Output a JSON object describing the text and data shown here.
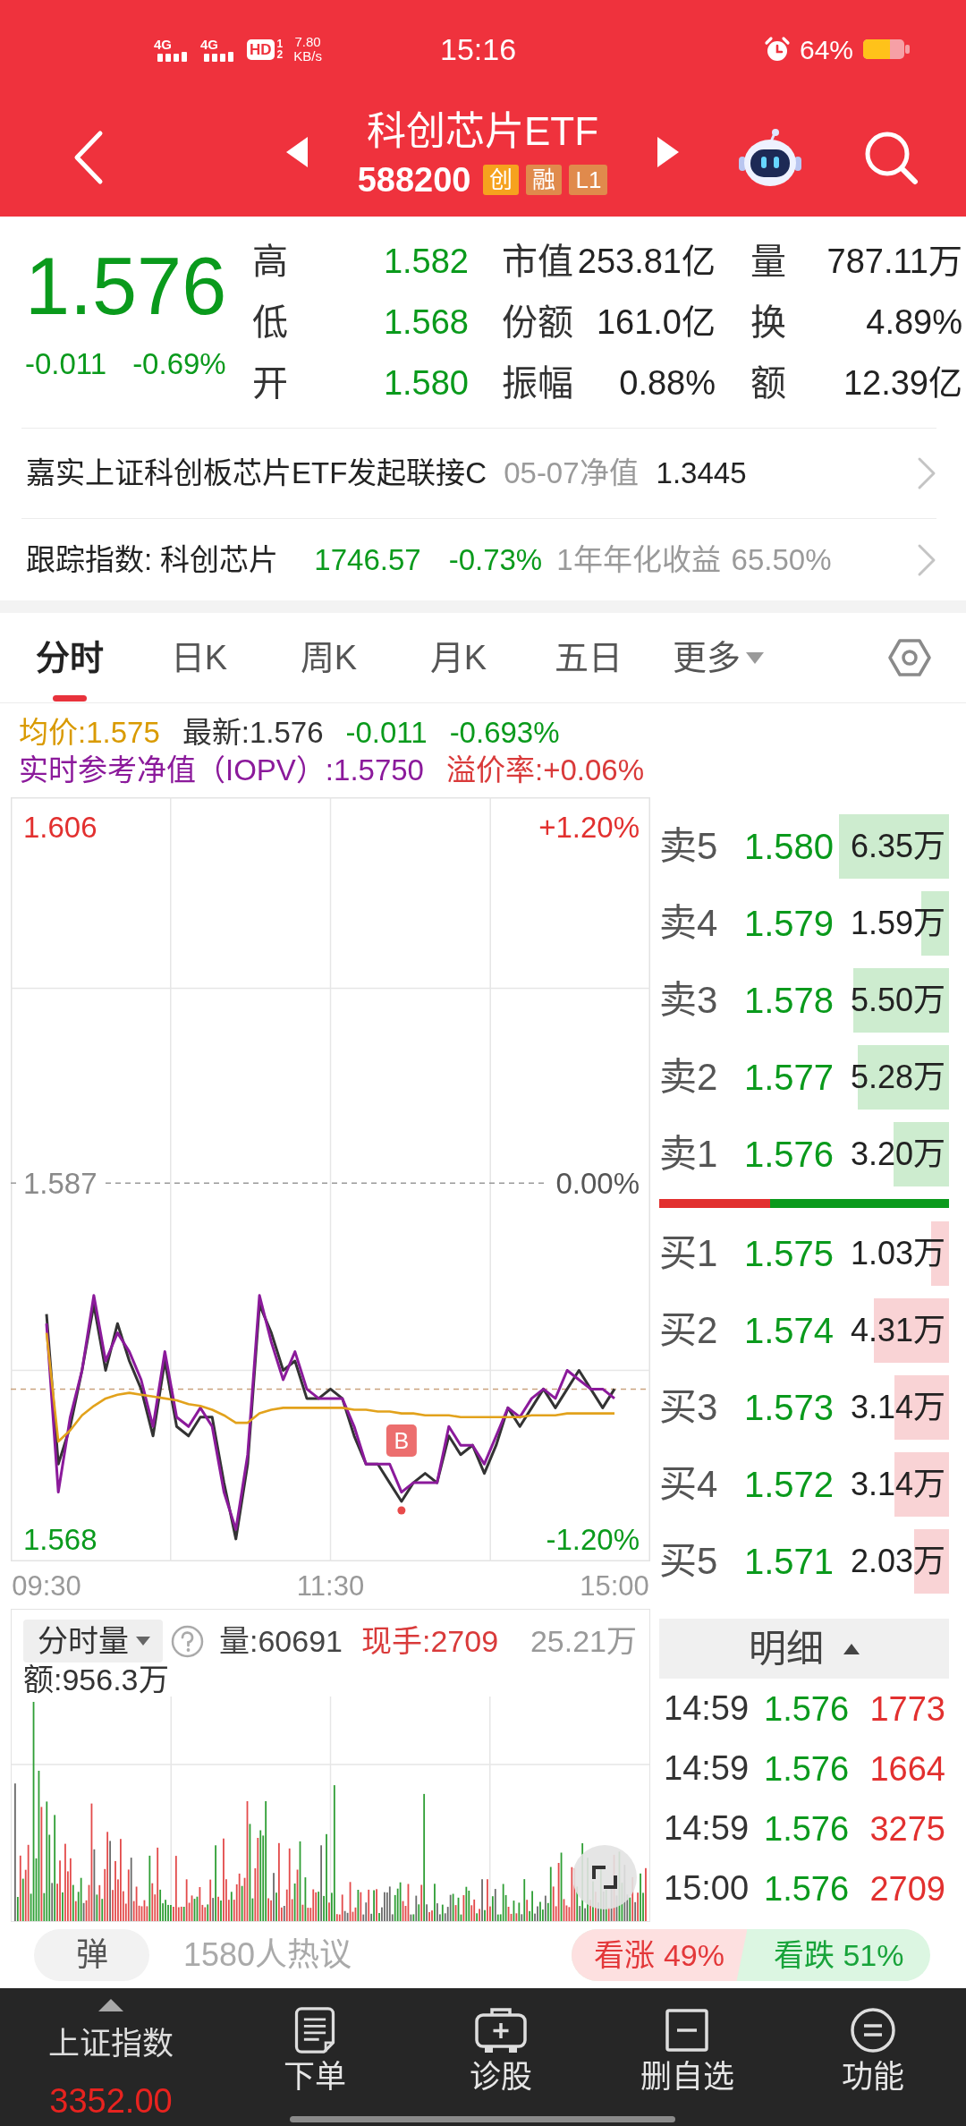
{
  "status_bar": {
    "networks": [
      "4G",
      "4G"
    ],
    "hd": "HD",
    "sim_slots": [
      "1",
      "2"
    ],
    "speed": "7.80",
    "speed_unit": "KB/s",
    "time": "15:16",
    "battery": "64%"
  },
  "header": {
    "title": "科创芯片ETF",
    "code": "588200",
    "tags": [
      {
        "text": "创",
        "color": "#f6a21e"
      },
      {
        "text": "融",
        "color": "#e08a4c"
      },
      {
        "text": "L1",
        "color": "#e08a4c"
      }
    ]
  },
  "quote": {
    "price_down": true,
    "price": "1.576",
    "change": "-0.011",
    "change_pct": "-0.69%",
    "stats": [
      [
        {
          "label": "高",
          "value": "1.582",
          "kind": "price"
        },
        {
          "label": "市值",
          "value": "253.81亿",
          "kind": "figure"
        },
        {
          "label": "量",
          "value": "787.11万",
          "kind": "figure"
        }
      ],
      [
        {
          "label": "低",
          "value": "1.568",
          "kind": "price"
        },
        {
          "label": "份额",
          "value": "161.0亿",
          "kind": "figure"
        },
        {
          "label": "换",
          "value": "4.89%",
          "kind": "figure"
        }
      ],
      [
        {
          "label": "开",
          "value": "1.580",
          "kind": "price"
        },
        {
          "label": "振幅",
          "value": "0.88%",
          "kind": "figure"
        },
        {
          "label": "额",
          "value": "12.39亿",
          "kind": "figure"
        }
      ]
    ]
  },
  "fund_link": {
    "name": "嘉实上证科创板芯片ETF发起联接C",
    "nav_label": "05-07净值",
    "nav": "1.3445"
  },
  "index_link": {
    "label": "跟踪指数: 科创芯片",
    "value": "1746.57",
    "change": "-0.73%",
    "down": true,
    "return_label": "1年年化收益",
    "return": "65.50%"
  },
  "tabs": [
    {
      "label": "分时",
      "selected": true,
      "kind": "tab"
    },
    {
      "label": "日K",
      "selected": false,
      "kind": "tab"
    },
    {
      "label": "周K",
      "selected": false,
      "kind": "tab"
    },
    {
      "label": "月K",
      "selected": false,
      "kind": "tab"
    },
    {
      "label": "五日",
      "selected": false,
      "kind": "tab"
    },
    {
      "label": "更多",
      "selected": false,
      "kind": "dropdown"
    }
  ],
  "intraday": {
    "average": "均价:1.575",
    "latest": "最新:1.576",
    "change": "-0.011",
    "change_pct": "-0.693%",
    "iopv": "实时参考净值（IOPV）:1.5750",
    "premium": "溢价率:+0.06%",
    "percent_ticks": [
      "+1.20%",
      "0.00%",
      "-1.20%"
    ],
    "chart_data": {
      "type": "line",
      "categories": [
        "09:30",
        null,
        null,
        null,
        null,
        null,
        null,
        null,
        null,
        null,
        null,
        null,
        null,
        null,
        null,
        null,
        null,
        null,
        null,
        null,
        null,
        null,
        null,
        null,
        "11:30",
        null,
        null,
        null,
        null,
        null,
        null,
        null,
        null,
        null,
        null,
        null,
        null,
        null,
        null,
        null,
        null,
        null,
        null,
        null,
        null,
        null,
        null,
        null,
        "15:00"
      ],
      "series": [
        {
          "color": "#333333",
          "values": [
            1.58,
            1.572,
            1.574,
            1.577,
            1.5805,
            1.577,
            1.5795,
            1.5775,
            1.576,
            1.5735,
            1.5775,
            1.574,
            1.5735,
            1.5745,
            1.5745,
            1.571,
            1.568,
            1.572,
            1.5805,
            1.579,
            1.577,
            1.5775,
            1.5755,
            1.5755,
            1.576,
            1.5755,
            1.5735,
            1.572,
            1.572,
            1.571,
            1.57,
            1.571,
            1.5715,
            1.571,
            1.5735,
            1.5725,
            1.573,
            1.5715,
            1.573,
            1.575,
            1.574,
            1.575,
            1.576,
            1.575,
            1.576,
            1.577,
            1.576,
            1.575,
            1.576
          ]
        },
        {
          "color": "#8b1a9b",
          "values": [
            1.5795,
            1.5705,
            1.5745,
            1.577,
            1.581,
            1.5775,
            1.579,
            1.578,
            1.5765,
            1.574,
            1.578,
            1.5745,
            1.574,
            1.575,
            1.574,
            1.5705,
            1.5685,
            1.5725,
            1.581,
            1.5785,
            1.5765,
            1.578,
            1.576,
            1.5755,
            1.5755,
            1.5755,
            1.574,
            1.572,
            1.572,
            1.572,
            1.5705,
            1.571,
            1.571,
            1.571,
            1.574,
            1.573,
            1.573,
            1.572,
            1.5735,
            1.575,
            1.5745,
            1.5755,
            1.576,
            1.5755,
            1.577,
            1.5765,
            1.576,
            1.576,
            1.5755
          ]
        },
        {
          "color": "#e2a21c",
          "values": [
            1.579,
            1.5732,
            1.5738,
            1.5746,
            1.5751,
            1.5755,
            1.5757,
            1.5758,
            1.5757,
            1.5756,
            1.5755,
            1.5754,
            1.5752,
            1.5751,
            1.5749,
            1.5746,
            1.5742,
            1.5742,
            1.5747,
            1.5749,
            1.575,
            1.575,
            1.575,
            1.575,
            1.575,
            1.575,
            1.5749,
            1.5749,
            1.5748,
            1.5748,
            1.5747,
            1.5747,
            1.5746,
            1.5746,
            1.5746,
            1.5745,
            1.5745,
            1.5745,
            1.5745,
            1.5745,
            1.5745,
            1.5746,
            1.5746,
            1.5746,
            1.5747,
            1.5747,
            1.5747,
            1.5747,
            1.5747
          ]
        }
      ],
      "ylim": [
        1.5668,
        1.6076
      ],
      "yticks": [
        {
          "value": 1.606,
          "label": "1.606"
        },
        {
          "value": 1.587,
          "label": "1.587"
        },
        {
          "value": 1.568,
          "label": "1.568"
        }
      ],
      "ref_lines": [
        {
          "axis": "y",
          "value": 1.576
        }
      ],
      "annotations": [
        {
          "y": 1.57,
          "text": "B"
        }
      ]
    }
  },
  "order_book": {
    "asks": [
      {
        "label": "卖5",
        "price": "1.580",
        "volume": "6.35万"
      },
      {
        "label": "卖4",
        "price": "1.579",
        "volume": "1.59万"
      },
      {
        "label": "卖3",
        "price": "1.578",
        "volume": "5.50万"
      },
      {
        "label": "卖2",
        "price": "1.577",
        "volume": "5.28万"
      },
      {
        "label": "卖1",
        "price": "1.576",
        "volume": "3.20万"
      }
    ],
    "bids": [
      {
        "label": "买1",
        "price": "1.575",
        "volume": "1.03万"
      },
      {
        "label": "买2",
        "price": "1.574",
        "volume": "4.31万"
      },
      {
        "label": "买3",
        "price": "1.573",
        "volume": "3.14万"
      },
      {
        "label": "买4",
        "price": "1.572",
        "volume": "3.14万"
      },
      {
        "label": "买5",
        "price": "1.571",
        "volume": "2.03万"
      }
    ]
  },
  "volume": {
    "selector": "分时量",
    "volume": "量:60691",
    "current": "现手:2709",
    "axis_max": "25.21万",
    "amount": "额:956.3万"
  },
  "trades": {
    "title": "明细",
    "rows": [
      {
        "time": "14:59",
        "price": "1.576",
        "volume": "1773",
        "buy": true
      },
      {
        "time": "14:59",
        "price": "1.576",
        "volume": "1664",
        "buy": true
      },
      {
        "time": "14:59",
        "price": "1.576",
        "volume": "3275",
        "buy": true
      },
      {
        "time": "15:00",
        "price": "1.576",
        "volume": "2709",
        "buy": true
      }
    ]
  },
  "discussion": {
    "button": "弹",
    "count": "1580人热议",
    "bullish": "看涨 49%",
    "bearish": "看跌 51%"
  },
  "bottom_nav": {
    "index_name": "上证指数",
    "index_value": "3352.00",
    "items": [
      {
        "label": "下单",
        "kind": "order"
      },
      {
        "label": "诊股",
        "kind": "diagnose"
      },
      {
        "label": "删自选",
        "kind": "remove"
      },
      {
        "label": "功能",
        "kind": "menu"
      }
    ]
  }
}
